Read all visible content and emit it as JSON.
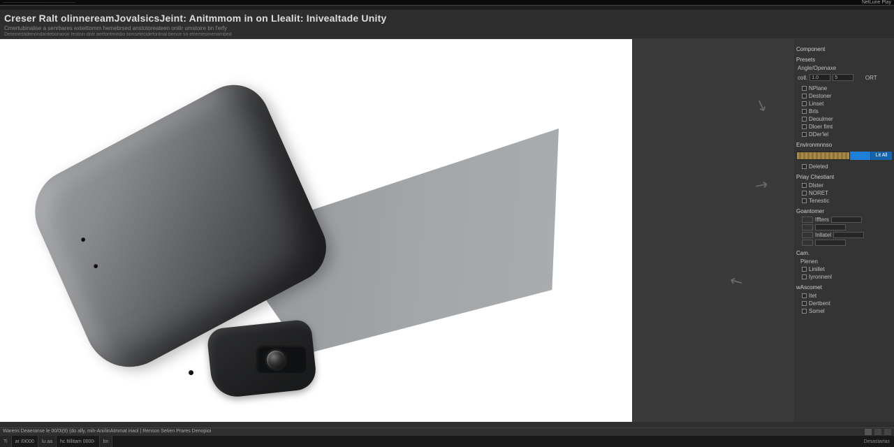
{
  "top_strip": {
    "left_text": "····················································",
    "right_text": "NetLune  Play"
  },
  "header": {
    "title": "Creser Ralt olinnereamJovalsicsJeint: Anitmmom in on Llealit: Inivealtade Unity",
    "sub1": "Cmertubinalise a senrbares exteittomm hemebrsed anstotoreateen onilir umstoire bn l'erfy",
    "sub2": "Deteinestidenondantebonaroir testsin dotr aerforitmmbo tionselecidefontnal bence sn etremesmenambed"
  },
  "inspector": {
    "sec_component": "Component",
    "sec_presets": "Presets",
    "sec_ang": "Angle/Openaxe",
    "num_a": "1.0",
    "num_b": "5",
    "pill_text": "ORT",
    "items1": [
      "NPlane",
      "Destoner",
      "Linset",
      "Brls",
      "Deoulmer",
      "Dloer fimt",
      "DDer'lel"
    ],
    "sec_env": "Environmnnso",
    "sel_label": "Deleted",
    "sel_tag": "Lit All",
    "sec_pc": "Priay  Chestiant",
    "items2": [
      "Dlster",
      "NORET",
      "Tenestic"
    ],
    "sec_geo": "Goantomer",
    "geo": [
      "Iffters",
      "",
      "Inllatel",
      ""
    ],
    "sec_cam": "Cam.",
    "sec_cam2": "Plenen",
    "cams": [
      "Linillet",
      "Iyronnenl"
    ],
    "sec_adv": "wAscomet",
    "advs": [
      "Itet",
      "Dertbent",
      "Somel"
    ]
  },
  "status": {
    "line1_left": "Warens Deaeranse le  00/0i(9) (do ally, mih-Ani/iinAtmmat iriaol | Renson Setien Prares Denopioi",
    "seg1": "Ti",
    "seg2": "ar /0i000",
    "seg3": "lu aa",
    "seg4": "hc  ltillitam  0000-",
    "seg5": "bn",
    "right": "Desastartas"
  }
}
